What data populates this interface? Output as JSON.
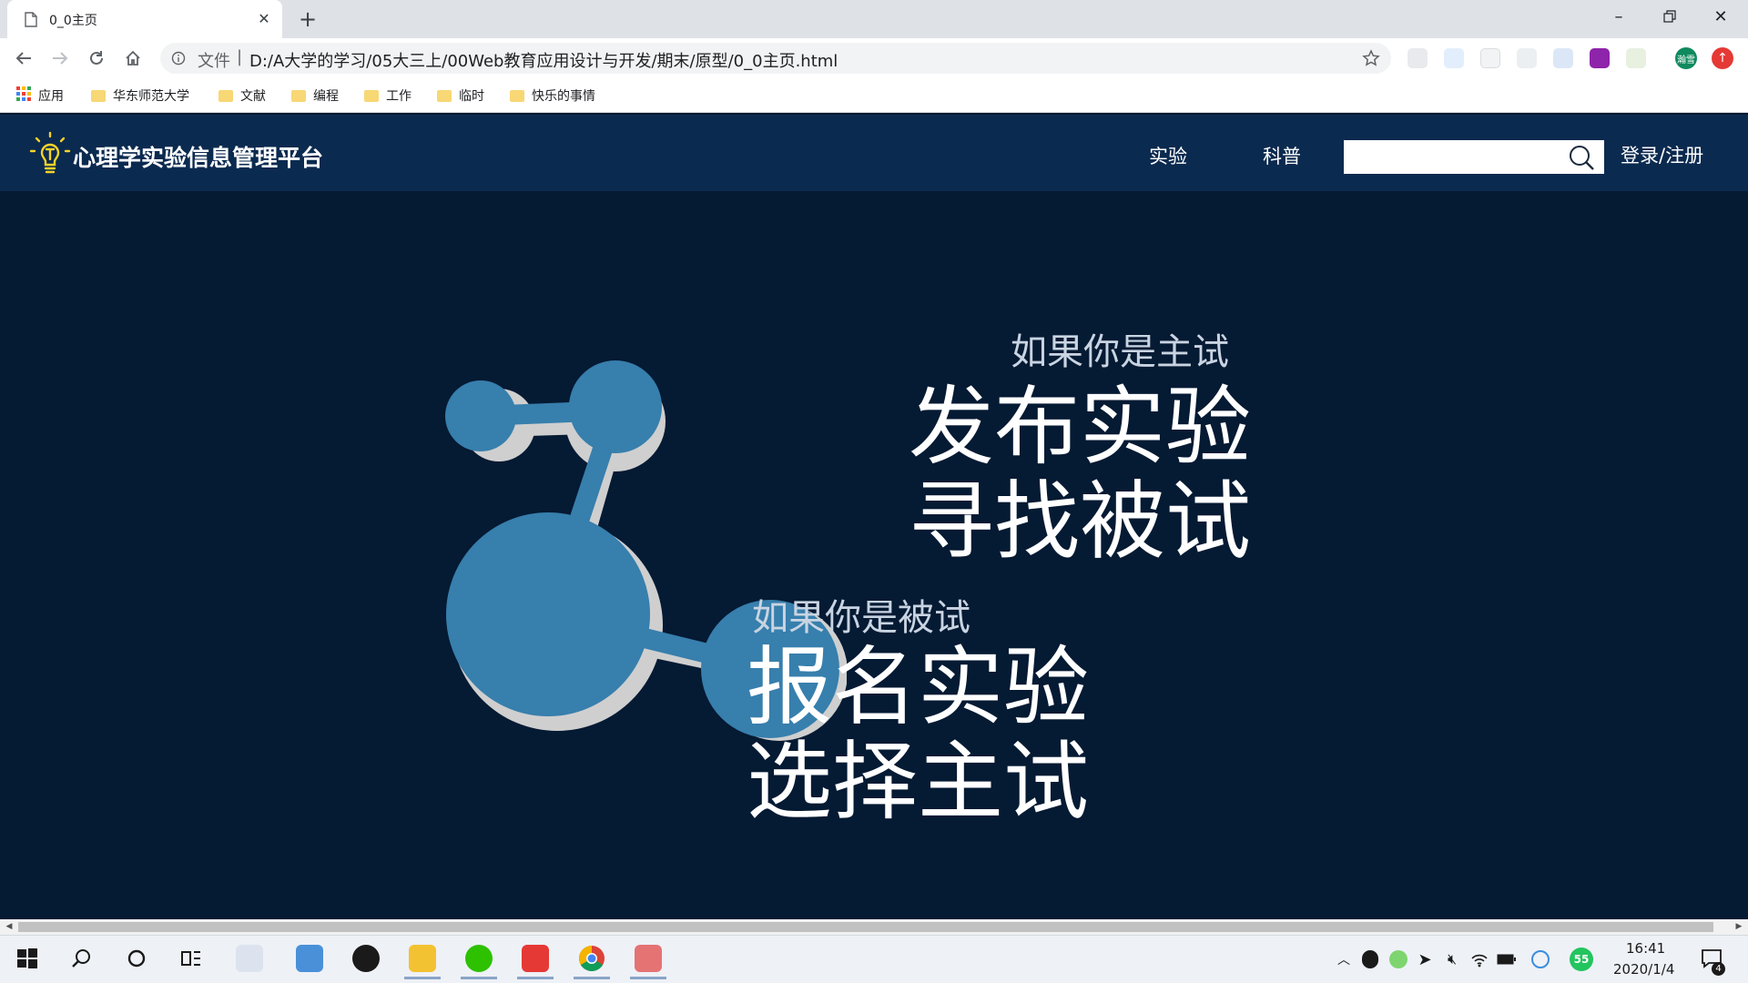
{
  "browser": {
    "tab_title": "0_0主页",
    "url_prefix": "文件",
    "url": "D:/A大学的学习/05大三上/00Web教育应用设计与开发/期末/原型/0_0主页.html",
    "bookmarks": [
      "应用",
      "华东师范大学",
      "文献",
      "编程",
      "工作",
      "临时",
      "快乐的事情"
    ],
    "icons": {
      "back": "back-arrow-icon",
      "forward": "forward-arrow-icon",
      "reload": "reload-icon",
      "home": "home-icon",
      "info": "info-icon",
      "star": "star-icon",
      "apps": "apps-grid-icon",
      "folder": "folder-icon"
    },
    "profile_badge": "瀚雪"
  },
  "site": {
    "brand": "心理学实验信息管理平台",
    "nav": [
      "实验",
      "科普"
    ],
    "search_placeholder": "",
    "auth": "登录/注册",
    "section_experimenter": {
      "lead": "如果你是主试",
      "lines": [
        "发布实验",
        "寻找被试"
      ]
    },
    "section_participant": {
      "lead": "如果你是被试",
      "lines": [
        "报名实验",
        "选择主试"
      ]
    },
    "colors": {
      "navbar": "#0b2a4f",
      "background": "#051a33",
      "molecule": "#377fad",
      "molecule_shadow": "#cfcfcf",
      "bulb": "#f2d32a"
    }
  },
  "taskbar": {
    "time": "16:41",
    "date": "2020/1/4",
    "notification_count": "4",
    "badge_55": "55"
  }
}
